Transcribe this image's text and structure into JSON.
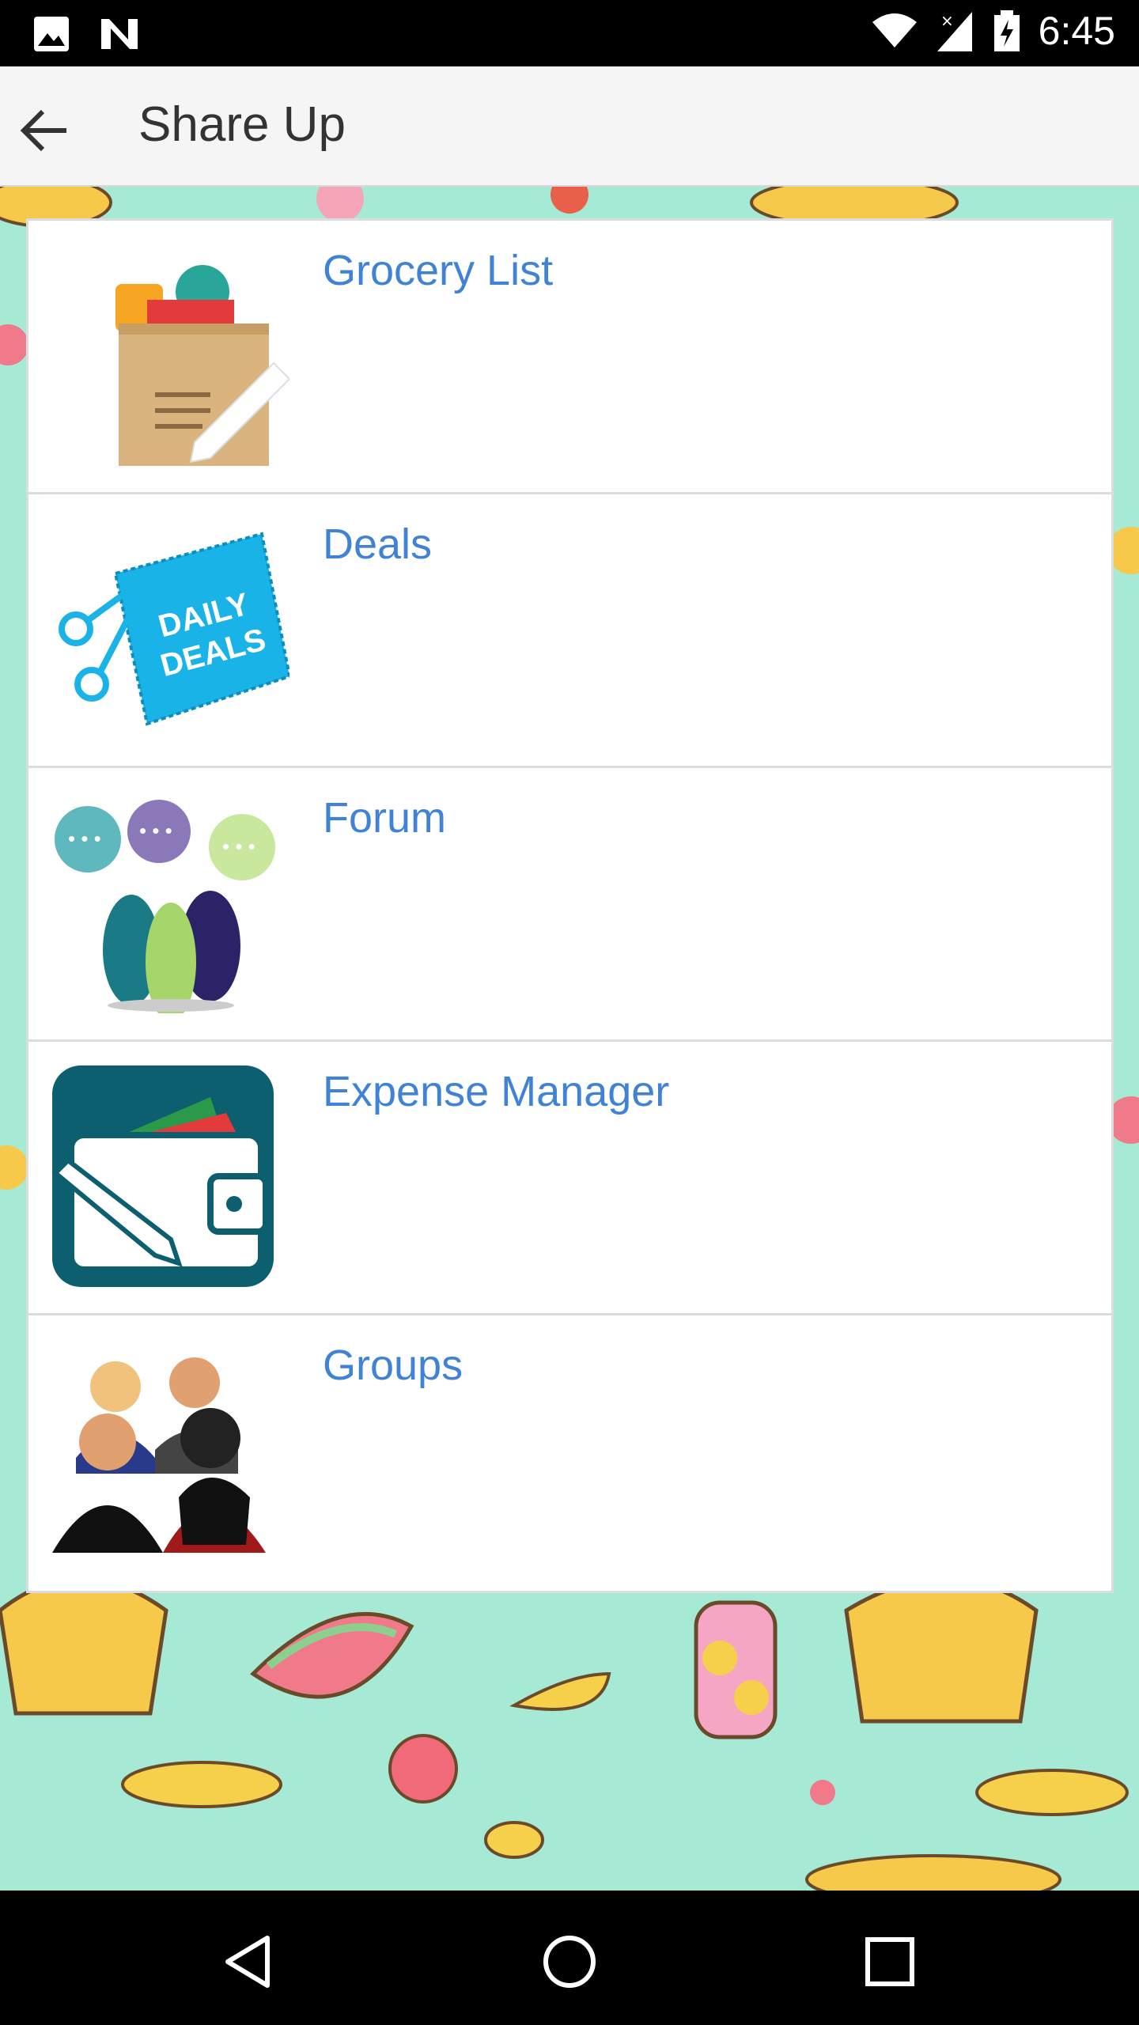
{
  "status_bar": {
    "time": "6:45"
  },
  "app_bar": {
    "title": "Share Up"
  },
  "menu": {
    "items": [
      {
        "label": "Grocery List",
        "icon": "grocery-bag-icon"
      },
      {
        "label": "Deals",
        "icon": "daily-deals-icon"
      },
      {
        "label": "Forum",
        "icon": "forum-people-icon"
      },
      {
        "label": "Expense Manager",
        "icon": "wallet-icon"
      },
      {
        "label": "Groups",
        "icon": "group-people-icon"
      }
    ]
  },
  "deals_icon_text": [
    "DAILY",
    "DEALS"
  ],
  "colors": {
    "link": "#3f82d6",
    "background": "#a6e9d4",
    "appbar": "#f5f5f5"
  }
}
